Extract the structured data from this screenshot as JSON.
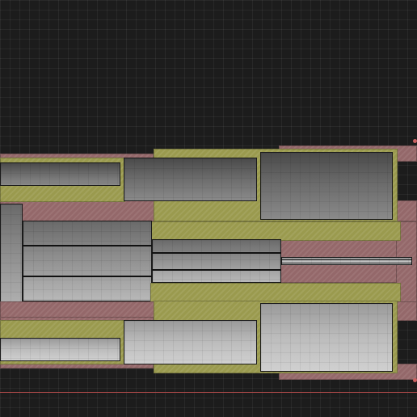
{
  "canvas": {
    "background": "#1c1c1c",
    "grid_color": "rgba(255,255,255,0.055)"
  },
  "colors": {
    "pink_layer": "#94686a",
    "yellow_layer": "#9a9a4e",
    "gray_block": "#8e8e8e",
    "baseline": "#b24a4a"
  }
}
